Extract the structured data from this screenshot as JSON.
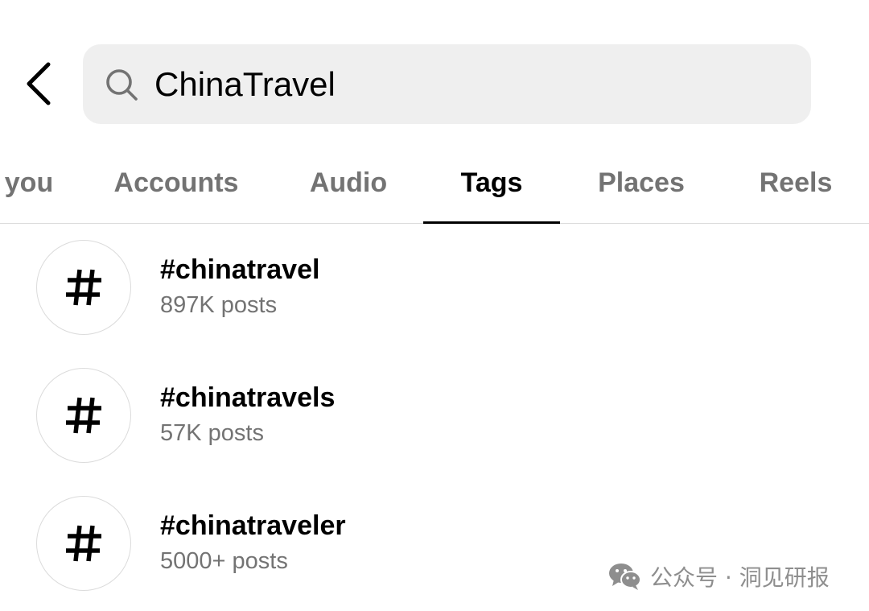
{
  "search": {
    "query": "ChinaTravel",
    "back_icon": "chevron-left-icon",
    "search_icon": "search-icon"
  },
  "tabs": [
    {
      "label": "you",
      "active": false
    },
    {
      "label": "Accounts",
      "active": false
    },
    {
      "label": "Audio",
      "active": false
    },
    {
      "label": "Tags",
      "active": true
    },
    {
      "label": "Places",
      "active": false
    },
    {
      "label": "Reels",
      "active": false
    }
  ],
  "results": [
    {
      "icon": "hashtag-icon",
      "tag": "#chinatravel",
      "posts": "897K posts"
    },
    {
      "icon": "hashtag-icon",
      "tag": "#chinatravels",
      "posts": "57K posts"
    },
    {
      "icon": "hashtag-icon",
      "tag": "#chinatraveler",
      "posts": "5000+ posts"
    }
  ],
  "watermark": {
    "icon": "wechat-logo-icon",
    "text": "公众号 · 洞见研报"
  },
  "colors": {
    "text_primary": "#000000",
    "text_secondary": "#737373",
    "search_bg": "#efefef",
    "divider": "#dbdbdb"
  }
}
